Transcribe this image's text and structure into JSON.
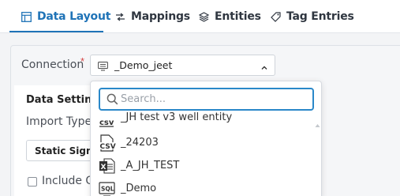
{
  "tabs": [
    {
      "label": "Data Layout",
      "icon": "table-icon",
      "active": true
    },
    {
      "label": "Mappings",
      "icon": "mapping-icon",
      "active": false
    },
    {
      "label": "Entities",
      "icon": "layers-icon",
      "active": false
    },
    {
      "label": "Tag Entries",
      "icon": "tag-icon",
      "active": false
    }
  ],
  "connection": {
    "label": "Connection",
    "required_mark": "*",
    "value": "_Demo_jeet",
    "value_icon": "database-icon"
  },
  "data_settings": {
    "title": "Data Settings",
    "import_type_label": "Import Type",
    "import_type_value": "Static Signals",
    "include_label": "Include Op"
  },
  "dropdown": {
    "search_placeholder": "Search...",
    "options": [
      {
        "label": "_JH test v3 well entity",
        "icon": "csv-file-icon"
      },
      {
        "label": "_24203",
        "icon": "csv-file-icon"
      },
      {
        "label": "_A_JH_TEST",
        "icon": "excel-file-icon"
      },
      {
        "label": "_Demo",
        "icon": "sql-file-icon"
      }
    ]
  },
  "colors": {
    "accent": "#1f73b7",
    "required": "#d64545"
  }
}
